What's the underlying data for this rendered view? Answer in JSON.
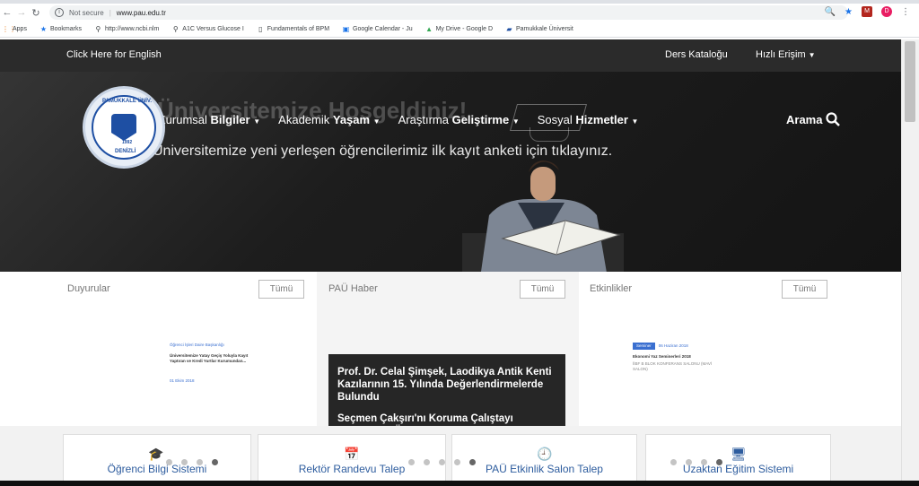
{
  "browser": {
    "security_label": "Not secure",
    "url": "www.pau.edu.tr",
    "avatar_letter": "D",
    "bookmarks": [
      {
        "label": "Apps",
        "icon": "apps-grid-icon"
      },
      {
        "label": "Bookmarks",
        "icon": "star-icon"
      },
      {
        "label": "http://www.ncbi.nlm",
        "icon": "link-icon"
      },
      {
        "label": "A1C Versus Glucose I",
        "icon": "link-icon"
      },
      {
        "label": "Fundamentals of BPM",
        "icon": "page-icon"
      },
      {
        "label": "Google Calendar - Ju",
        "icon": "calendar-icon"
      },
      {
        "label": "My Drive - Google D",
        "icon": "drive-icon"
      },
      {
        "label": "Pamukkale Üniversit",
        "icon": "page-icon"
      }
    ]
  },
  "site": {
    "english_link": "Click Here for English",
    "ders_katalogu": "Ders Kataloğu",
    "hizli_erisim": "Hızlı Erişim",
    "hero_title": "Üniversitemize Hoşgeldiniz!",
    "hero_sub": "Üniversitemize yeni yerleşen öğrencilerimiz ilk kayıt anketi için tıklayınız.",
    "nav": [
      {
        "light": "Kurumsal",
        "bold": "Bilgiler"
      },
      {
        "light": "Akademik",
        "bold": "Yaşam"
      },
      {
        "light": "Araştırma",
        "bold": "Geliştirme"
      },
      {
        "light": "Sosyal",
        "bold": "Hizmetler"
      }
    ],
    "search_label": "Arama",
    "logo": {
      "top": "PAMUKKALE ÜNİVERSİTESİ",
      "bottom": "DENİZLİ",
      "year": "1992"
    }
  },
  "panels": [
    {
      "title": "Duyurular",
      "button": "Tümü"
    },
    {
      "title": "PAÜ Haber",
      "button": "Tümü"
    },
    {
      "title": "Etkinlikler",
      "button": "Tümü"
    }
  ],
  "duyuru_preview": {
    "dept": "Öğrenci İşleri Daire Başkanlığı",
    "line1": "Üniversitemize Yatay Geçiş Yoluyla Kayıt",
    "line2": "Yaptıran ve Kredi Yurtlar Kurumundan...",
    "date": "01 Ekim 2018"
  },
  "etkinlik_preview": {
    "tag": "Seminer",
    "date": "06 Haziran 2018",
    "title": "Ekonomi Yaz Seminerleri 2018",
    "place1": "İİBF B BLOK KONFERANS SALONU (MAVİ",
    "place2": "SALON)"
  },
  "news": [
    "Prof. Dr. Celal Şimşek, Laodikya Antik Kenti Kazılarının 15. Yılında Değerlendirmelerde Bulundu",
    "Seçmen Çakşırı'nı Koruma Çalıştayı Pamukkale Üniversitesi Ev Sahipliğinde Yapıldı"
  ],
  "quick_links": [
    {
      "label": "Öğrenci Bilgi Sistemi",
      "icon": "graduation-cap-icon"
    },
    {
      "label": "Rektör Randevu Talep",
      "icon": "calendar-icon"
    },
    {
      "label": "PAÜ Etkinlik Salon Talep",
      "icon": "clock-icon"
    },
    {
      "label": "Uzaktan Eğitim Sistemi",
      "icon": "monitor-icon"
    }
  ]
}
